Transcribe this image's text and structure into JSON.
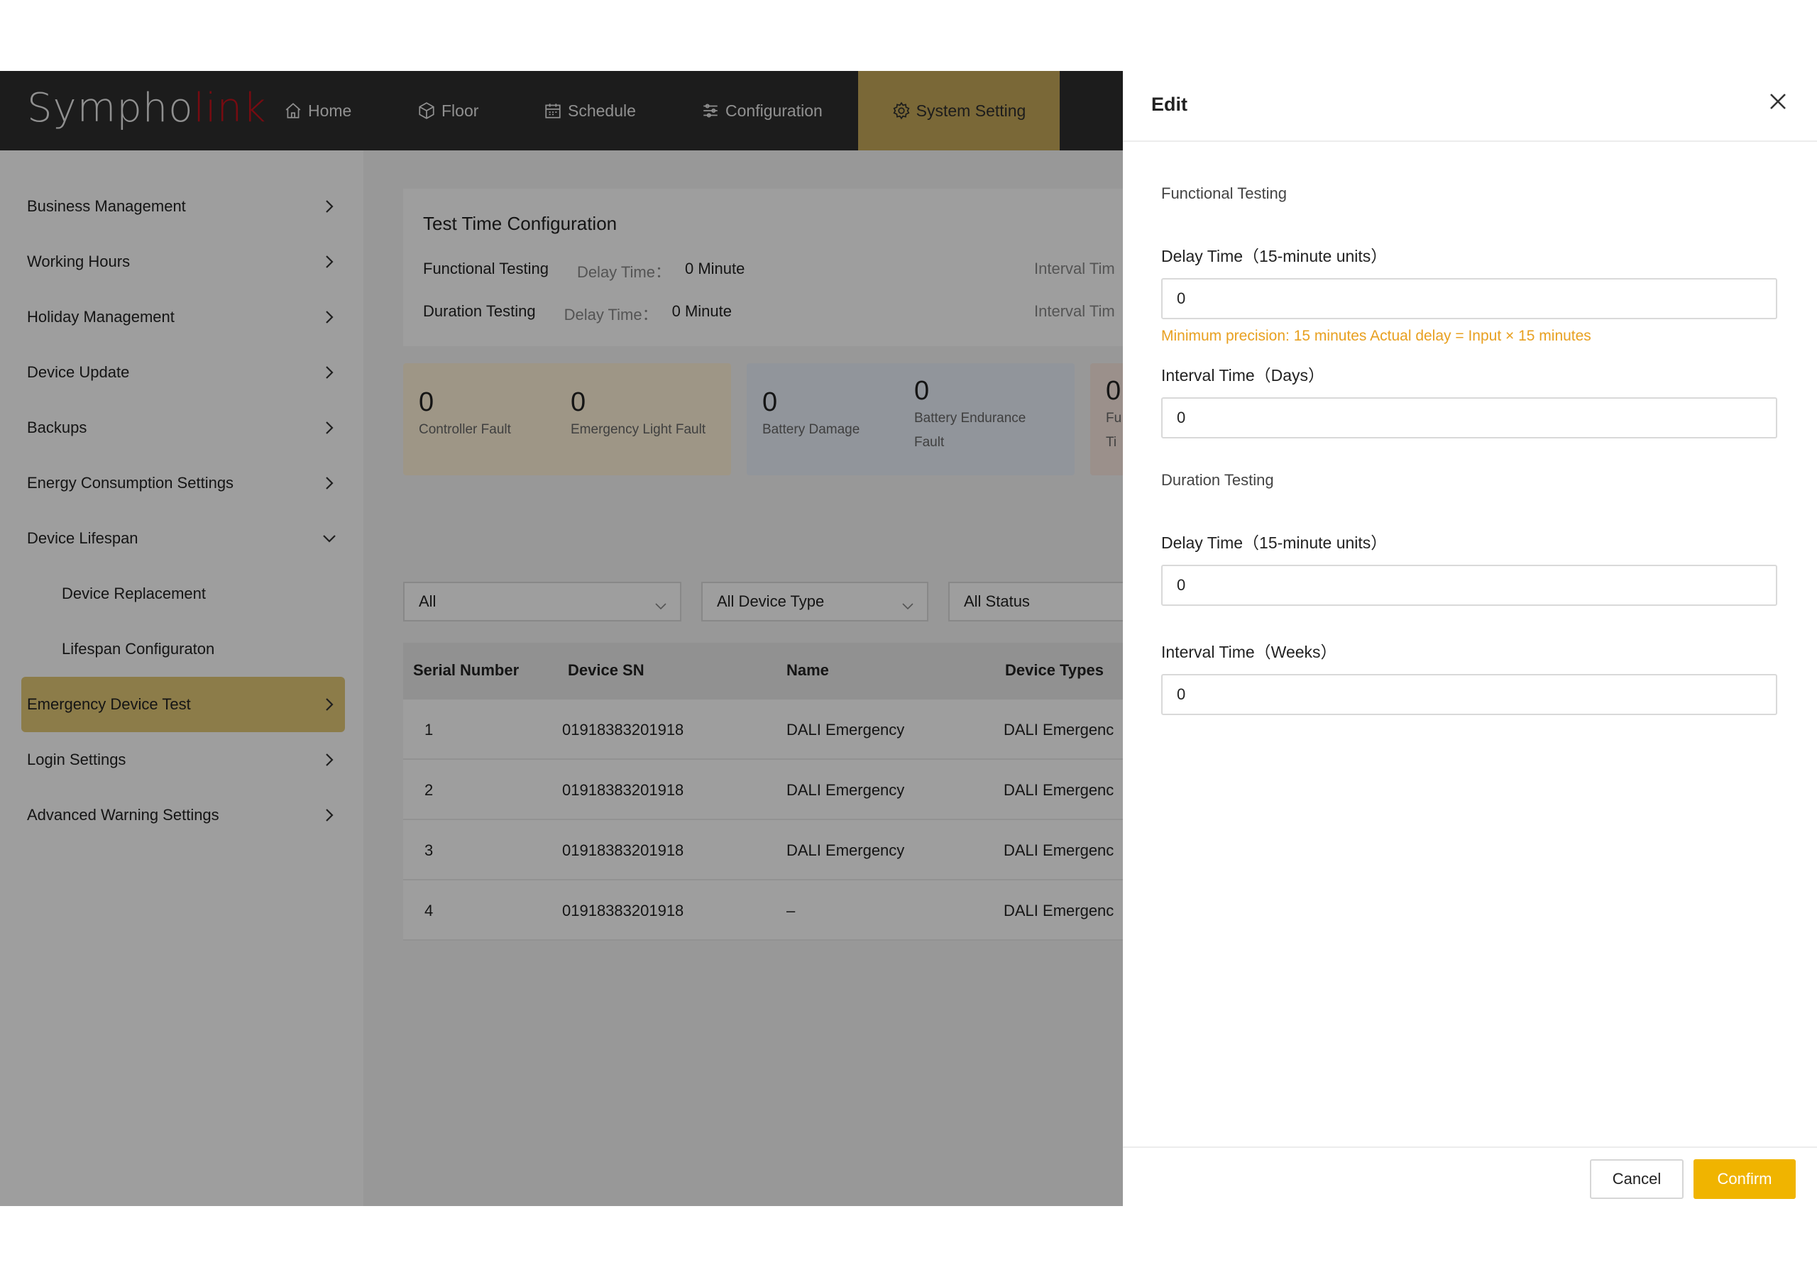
{
  "app": {
    "logo_main": "Sympho",
    "logo_accent": "link"
  },
  "nav": [
    {
      "label": "Home",
      "icon": "home-icon"
    },
    {
      "label": "Floor",
      "icon": "cube-icon"
    },
    {
      "label": "Schedule",
      "icon": "calendar-icon"
    },
    {
      "label": "Configuration",
      "icon": "sliders-icon"
    },
    {
      "label": "System Setting",
      "icon": "gear-icon",
      "active": true
    }
  ],
  "sidebar": {
    "items": [
      {
        "label": "Business Management"
      },
      {
        "label": "Working  Hours"
      },
      {
        "label": "Holiday Management"
      },
      {
        "label": "Device Update"
      },
      {
        "label": "Backups"
      },
      {
        "label": "Energy Consumption Settings"
      },
      {
        "label": "Device Lifespan",
        "expanded": true
      },
      {
        "label": "Device Replacement",
        "sub": true
      },
      {
        "label": "Lifespan Configuraton",
        "sub": true
      },
      {
        "label": "Emergency Device Test",
        "active": true
      },
      {
        "label": "Login Settings"
      },
      {
        "label": "Advanced Warning Settings"
      }
    ]
  },
  "test_config": {
    "title": "Test Time Configuration",
    "functional_label": "Functional Testing",
    "duration_label": "Duration Testing",
    "delay_label": "Delay Time：",
    "functional_delay": "0 Minute",
    "duration_delay": "0 Minute",
    "interval_label": "Interval Tim"
  },
  "stats": [
    {
      "value": "0",
      "caption": "Controller Fault"
    },
    {
      "value": "0",
      "caption": "Emergency Light Fault"
    },
    {
      "value": "0",
      "caption": "Battery Damage"
    },
    {
      "value": "0",
      "caption_line1": "Battery Endurance",
      "caption_line2": "Fault"
    },
    {
      "value": "0",
      "caption_line1": "Fu",
      "caption_line2": "Ti"
    }
  ],
  "filters": {
    "scope": "All",
    "device_type": "All Device Type",
    "status": "All Status"
  },
  "table": {
    "headers": [
      "Serial Number",
      "Device SN",
      "Name",
      "Device Types"
    ],
    "rows": [
      [
        "1",
        "01918383201918",
        "DALI Emergency",
        "DALI Emergenc"
      ],
      [
        "2",
        "01918383201918",
        "DALI Emergency",
        "DALI Emergenc"
      ],
      [
        "3",
        "01918383201918",
        "DALI Emergency",
        "DALI Emergenc"
      ],
      [
        "4",
        "01918383201918",
        "–",
        "DALI Emergenc"
      ]
    ]
  },
  "drawer": {
    "title": "Edit",
    "functional_section": "Functional Testing",
    "f_delay_label": "Delay Time（15-minute units）",
    "f_delay_value": "0",
    "hint": "Minimum precision: 15 minutes Actual delay = Input × 15 minutes",
    "f_interval_label": "Interval Time（Days）",
    "f_interval_value": "0",
    "duration_section": "Duration Testing",
    "d_delay_label": "Delay Time（15-minute units）",
    "d_delay_value": "0",
    "d_interval_label": "Interval Time（Weeks）",
    "d_interval_value": "0",
    "cancel": "Cancel",
    "confirm": "Confirm"
  },
  "colors": {
    "nav_bg": "#2e2e2e",
    "active_gold": "#c6a95a",
    "sidebar_active": "#e3c877",
    "hint": "#e8a020",
    "confirm": "#f0b400",
    "logo_accent": "#c0121c"
  }
}
